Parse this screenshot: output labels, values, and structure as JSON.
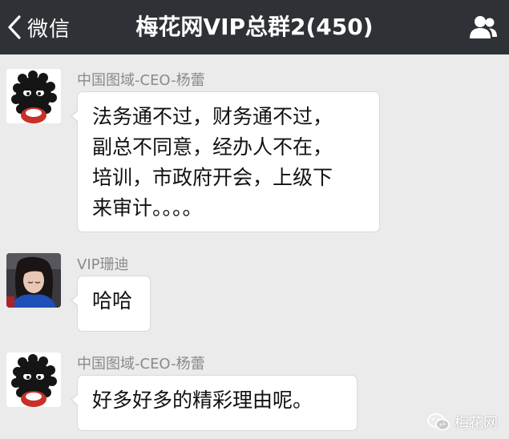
{
  "header": {
    "back_label": "微信",
    "title": "梅花网VIP总群2(450)",
    "back_icon": "chevron-left-icon",
    "members_icon": "group-members-icon"
  },
  "messages": [
    {
      "sender": "中国图域-CEO-杨蕾",
      "avatar": "black-fuzzball-avatar",
      "lines": [
        "法务通不过，财务通不过，",
        "副总不同意，经办人不在，",
        "培训，市政府开会，上级下",
        "来审计。。。。"
      ]
    },
    {
      "sender": "VIP珊迪",
      "avatar": "woman-photo-avatar",
      "lines": [
        "哈哈"
      ]
    },
    {
      "sender": "中国图域-CEO-杨蕾",
      "avatar": "black-fuzzball-avatar",
      "lines": [
        "好多好多的精彩理由呢。"
      ]
    }
  ],
  "watermark": {
    "text": "梅花网",
    "icon": "wechat-icon"
  },
  "colors": {
    "topbar": "#2e3135",
    "background": "#ebebeb",
    "bubble": "#ffffff"
  }
}
